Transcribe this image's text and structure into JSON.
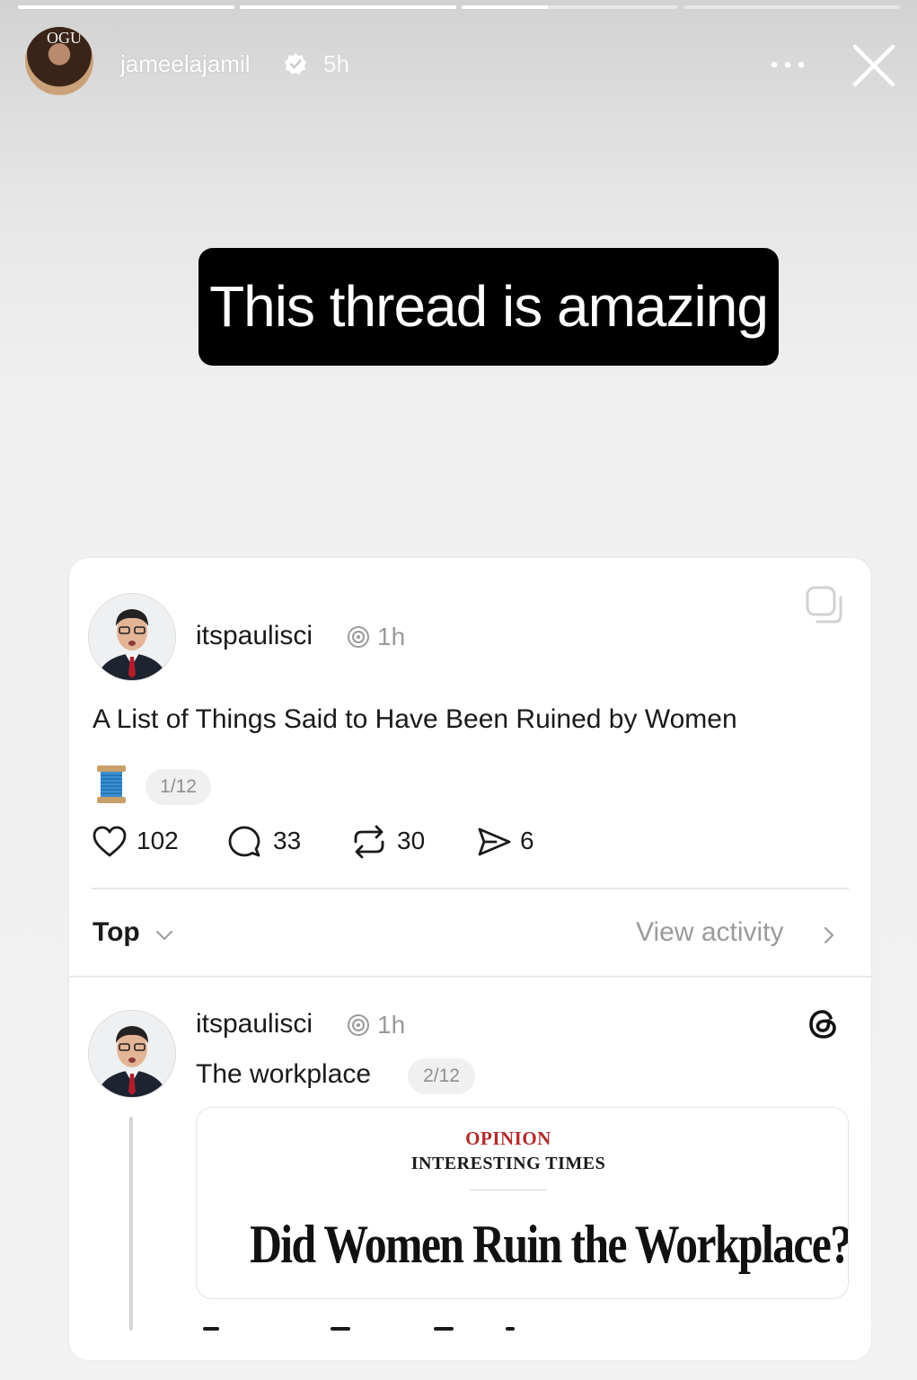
{
  "story": {
    "progress": [
      1.0,
      1.0,
      0.4,
      0.0
    ],
    "username": "jameelajamil",
    "time": "5h",
    "avatar_text": "OGU",
    "caption": "This thread is amazing"
  },
  "thread": {
    "post1": {
      "username": "itspaulisci",
      "time": "1h",
      "text": "A List of Things Said to Have Been Ruined by Women",
      "counter": "1/12",
      "likes": "102",
      "comments": "33",
      "reposts": "30",
      "shares": "6"
    },
    "sort_label": "Top",
    "view_activity": "View activity",
    "post2": {
      "username": "itspaulisci",
      "time": "1h",
      "text": "The workplace",
      "counter": "2/12",
      "article": {
        "section": "OPINION",
        "column": "INTERESTING TIMES",
        "headline": "Did Women Ruin the Workplace?"
      }
    }
  },
  "icons": {
    "verified": "verified-badge-icon",
    "more": "more-options-icon",
    "close": "close-icon",
    "copy": "copy-icon",
    "spool": "thread-spool-icon",
    "like": "heart-icon",
    "comment": "comment-icon",
    "repost": "repost-icon",
    "share": "share-icon",
    "threads": "threads-logo-icon"
  },
  "colors": {
    "caption_bg": "#000000",
    "opinion_red": "#b12b2b",
    "muted": "#9a9a9a"
  }
}
